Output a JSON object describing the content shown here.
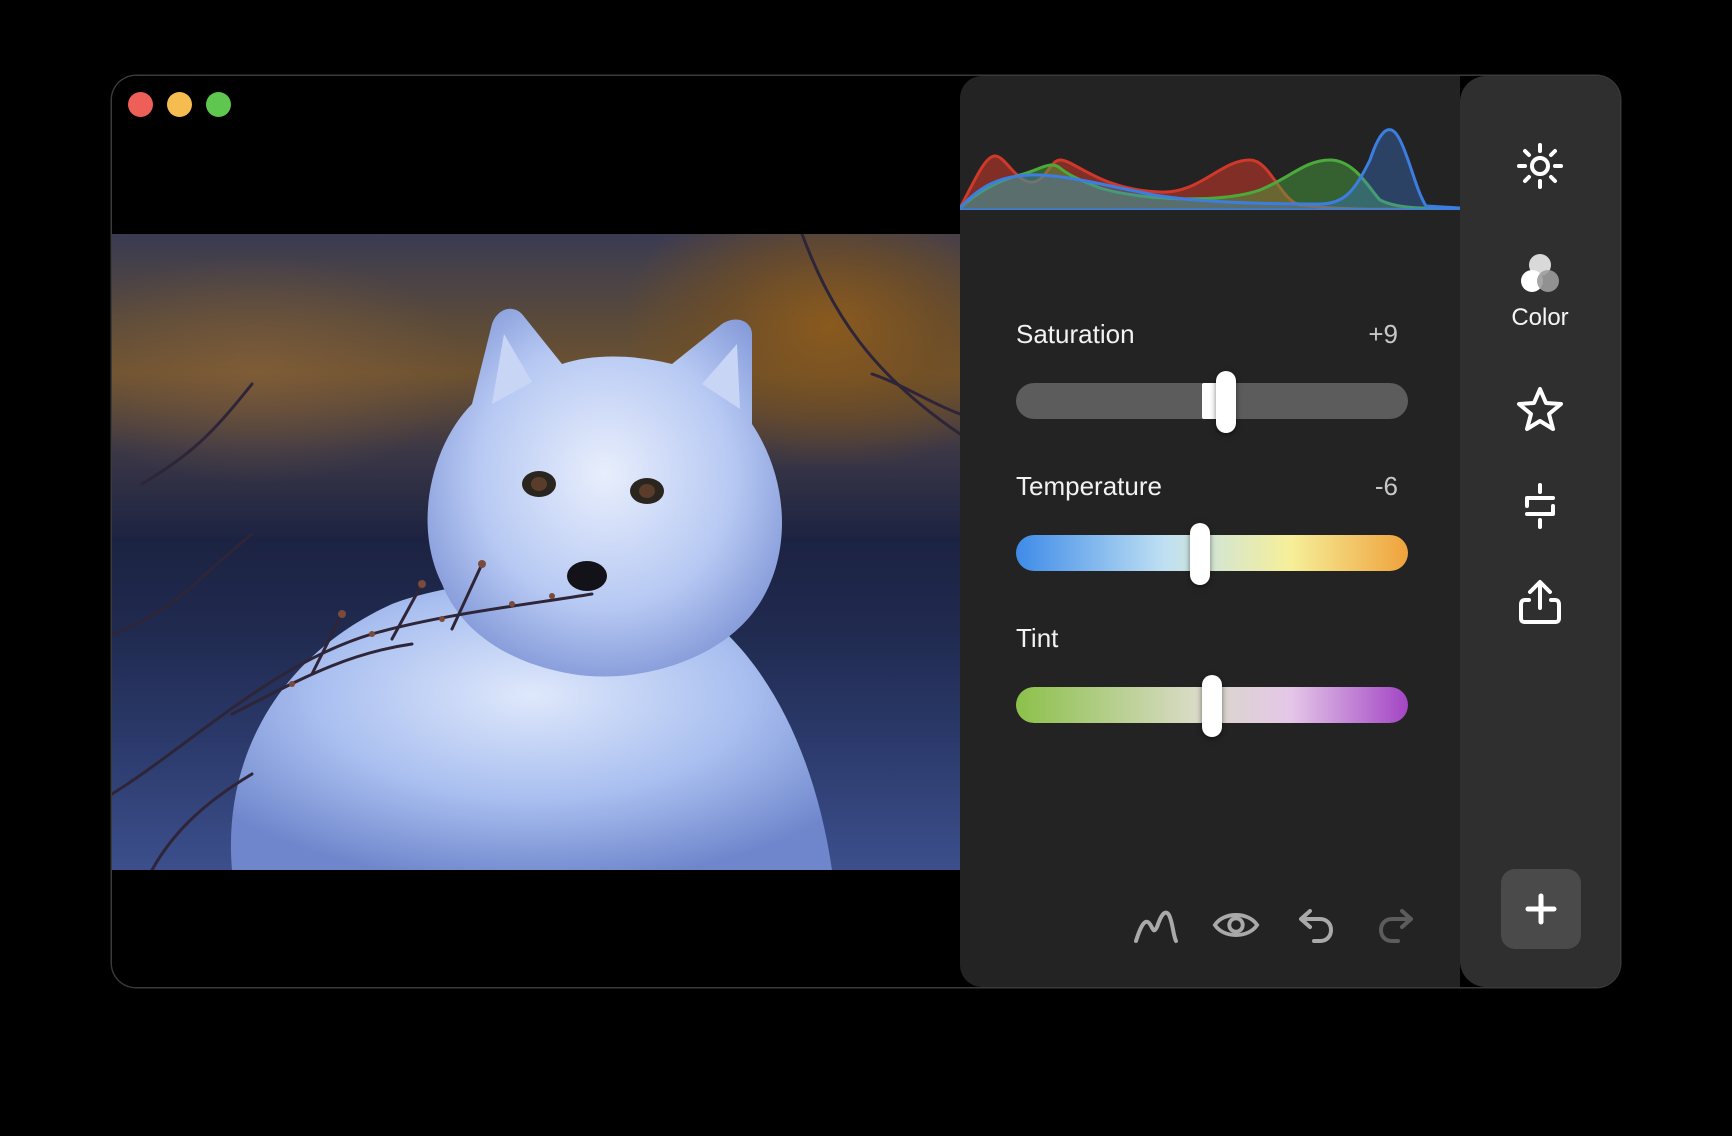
{
  "window": {
    "controls": [
      "close",
      "minimize",
      "zoom"
    ]
  },
  "photo": {
    "description_icon": "arctic-fox-photo"
  },
  "adjustments": [
    {
      "id": "saturation",
      "label": "Saturation",
      "value": "+9",
      "position": 0.53
    },
    {
      "id": "temperature",
      "label": "Temperature",
      "value": "-6",
      "position": 0.47
    },
    {
      "id": "tint",
      "label": "Tint",
      "value": "",
      "position": 0.5
    }
  ],
  "toolbar": {
    "icons": [
      "curves-icon",
      "eye-icon",
      "undo-icon",
      "redo-icon"
    ]
  },
  "rail": {
    "items": [
      {
        "icon": "sun-icon",
        "label": ""
      },
      {
        "icon": "color-circles-icon",
        "label": "Color",
        "active": true
      },
      {
        "icon": "star-icon",
        "label": ""
      },
      {
        "icon": "crop-icon",
        "label": ""
      },
      {
        "icon": "share-icon",
        "label": ""
      }
    ],
    "add_icon": "plus-icon"
  },
  "colors": {
    "panel_bg": "#232323",
    "rail_bg": "#2f2f2f",
    "temperature_gradient": [
      "#3e8be8",
      "#bfe0f3",
      "#f6ef9a",
      "#efa23c"
    ],
    "tint_gradient": [
      "#8cc04a",
      "#d8dbc4",
      "#e4c7e8",
      "#a345c4"
    ],
    "histogram": {
      "red": "#d0382b",
      "green": "#4caa3d",
      "blue": "#3c7ee0"
    }
  }
}
